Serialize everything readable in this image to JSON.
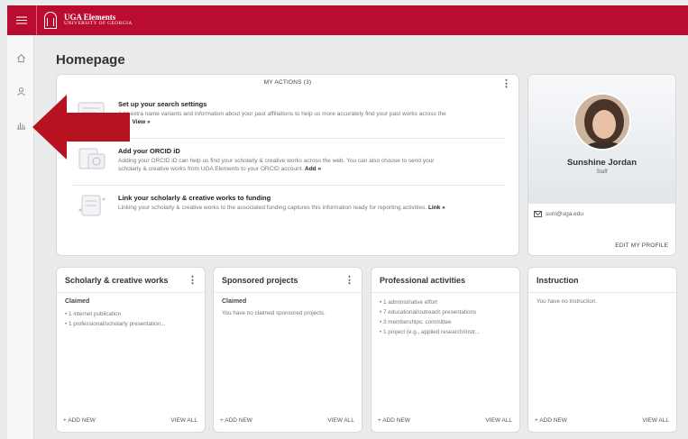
{
  "header": {
    "app_title": "UGA Elements",
    "app_subtitle": "UNIVERSITY OF GEORGIA"
  },
  "page": {
    "title": "Homepage"
  },
  "actions": {
    "header": "MY ACTIONS (3)",
    "items": [
      {
        "title": "Set up your search settings",
        "text": "Add extra name variants and information about your past affiliations to help us more accurately find your past works across the web.",
        "link": "View »"
      },
      {
        "title": "Add your ORCID iD",
        "text": "Adding your ORCID iD can help us find your scholarly & creative works across the web. You can also choose to send your scholarly & creative works from UGA Elements to your ORCID account.",
        "link": "Add »"
      },
      {
        "title": "Link your scholarly & creative works to funding",
        "text": "Linking your scholarly & creative works to the associated funding captures this information ready for reporting activities.",
        "link": "Link »"
      }
    ]
  },
  "profile": {
    "name": "Sunshine Jordan",
    "role": "Staff",
    "email": "suni@uga.edu",
    "edit_label": "EDIT MY PROFILE"
  },
  "boxes": {
    "scholarly": {
      "title": "Scholarly & creative works",
      "subtitle": "Claimed",
      "items": [
        "• 1 internet publication",
        "• 1 professional/scholarly presentation..."
      ],
      "add": "+ ADD NEW",
      "view": "VIEW ALL"
    },
    "sponsored": {
      "title": "Sponsored projects",
      "subtitle": "Claimed",
      "text": "You have no claimed sponsored projects.",
      "add": "+ ADD NEW",
      "view": "VIEW ALL"
    },
    "professional": {
      "title": "Professional activities",
      "items": [
        "• 1 administrative effort",
        "• 7 educational/outreach presentations",
        "• 3 memberships: committee",
        "• 1 project (e.g., applied research/instr..."
      ],
      "add": "+ ADD NEW",
      "view": "VIEW ALL"
    },
    "instruction": {
      "title": "Instruction",
      "text": "You have no instruction.",
      "add": "+ ADD NEW",
      "view": "VIEW ALL"
    }
  },
  "colors": {
    "brand": "#ba0c2f",
    "arrow": "#b7121f"
  },
  "icons": {
    "menu": "hamburger-menu-icon",
    "logo": "uga-arch-logo-icon",
    "home": "home-icon",
    "person": "person-icon",
    "chart": "bar-chart-icon",
    "mail": "mail-icon",
    "kebab": "vertical-ellipsis-icon"
  }
}
